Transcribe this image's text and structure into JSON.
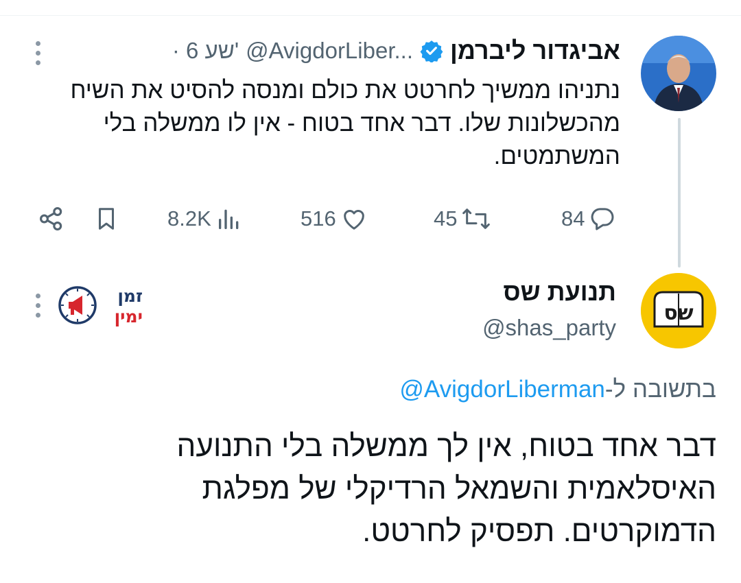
{
  "tweet": {
    "author_name": "אביגדור ליברמן",
    "author_handle": "@AvigdorLiber...",
    "time_meta": "· 6 שע'",
    "text": "נתניהו ממשיך לחרטט את כולם ומנסה להסיט את השיח מהכשלונות שלו. דבר אחד בטוח - אין לו ממשלה בלי המשתמטים.",
    "stats": {
      "replies": "84",
      "retweets": "45",
      "likes": "516",
      "views": "8.2K"
    }
  },
  "reply": {
    "author_name": "תנועת שס",
    "author_handle": "@shas_party",
    "avatar_text": "שס",
    "badge_line1": "זמן",
    "badge_line2": "ימין",
    "reply_prefix": "בתשובה ל-",
    "reply_mention": "@AvigdorLiberman",
    "text": "דבר אחד בטוח, אין לך ממשלה בלי התנועה האיסלאמית והשמאל הרדיקלי של מפלגת הדמוקרטים. תפסיק לחרטט."
  },
  "icons": [
    "more-icon",
    "verified-icon",
    "reply-icon",
    "retweet-icon",
    "like-icon",
    "views-icon",
    "bookmark-icon",
    "share-icon"
  ],
  "colors": {
    "accent": "#1d9bf0",
    "secondary_text": "#536471",
    "text": "#0f1419",
    "shas_yellow": "#f7c600",
    "badge_red": "#d7262d",
    "badge_navy": "#1f3a68"
  }
}
